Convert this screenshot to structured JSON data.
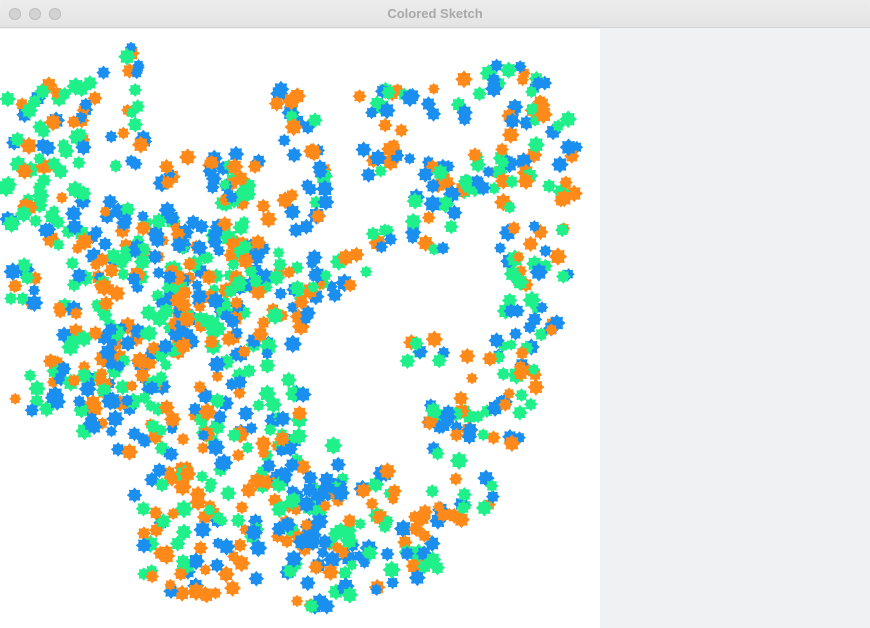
{
  "window": {
    "title": "Colored Sketch",
    "traffic_lights": [
      "close",
      "minimize",
      "zoom"
    ]
  },
  "sketch": {
    "palette": [
      "#1a8ff0",
      "#ff8a1a",
      "#1ff08a"
    ],
    "mark_shape": "gear-blob"
  }
}
